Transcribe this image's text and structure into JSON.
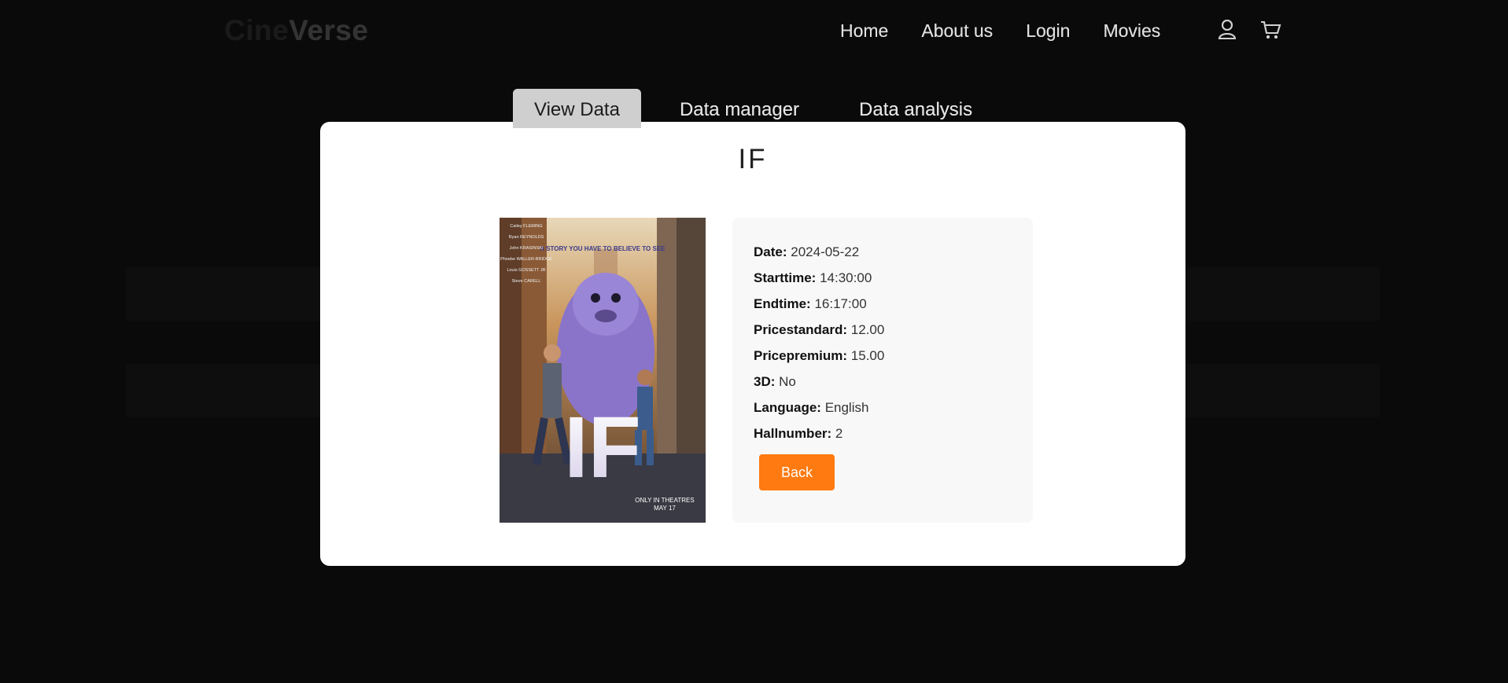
{
  "navbar": {
    "brand_part1": "Cine",
    "brand_part2": "Verse",
    "links": [
      "Home",
      "About us",
      "Login",
      "Movies"
    ],
    "icons": [
      "user-icon",
      "cart-icon"
    ]
  },
  "tabs": [
    {
      "label": "View Data",
      "active": true
    },
    {
      "label": "Data manager",
      "active": false
    },
    {
      "label": "Data analysis",
      "active": false
    }
  ],
  "modal": {
    "title": "IF",
    "poster": {
      "tagline": "A STORY YOU HAVE TO BELIEVE TO SEE",
      "cast": [
        "Cailey FLEMING",
        "Ryan REYNOLDS",
        "John KRASINSKI",
        "Phoebe WALLER-BRIDGE",
        "Louis GOSSETT JR",
        "Steve CARELL"
      ],
      "title": "IF",
      "footer_line1": "ONLY IN THEATRES",
      "footer_line2": "MAY 17"
    },
    "details": [
      {
        "label": "Date:",
        "value": "2024-05-22"
      },
      {
        "label": "Starttime:",
        "value": "14:30:00"
      },
      {
        "label": "Endtime:",
        "value": "16:17:00"
      },
      {
        "label": "Pricestandard:",
        "value": "12.00"
      },
      {
        "label": "Pricepremium:",
        "value": "15.00"
      },
      {
        "label": "3D:",
        "value": "No"
      },
      {
        "label": "Language:",
        "value": "English"
      },
      {
        "label": "Hallnumber:",
        "value": "2"
      }
    ],
    "back_label": "Back"
  },
  "colors": {
    "accent": "#ff7a10",
    "overlay": "#050505",
    "modal_bg": "#ffffff",
    "info_bg": "#f8f8f8"
  }
}
